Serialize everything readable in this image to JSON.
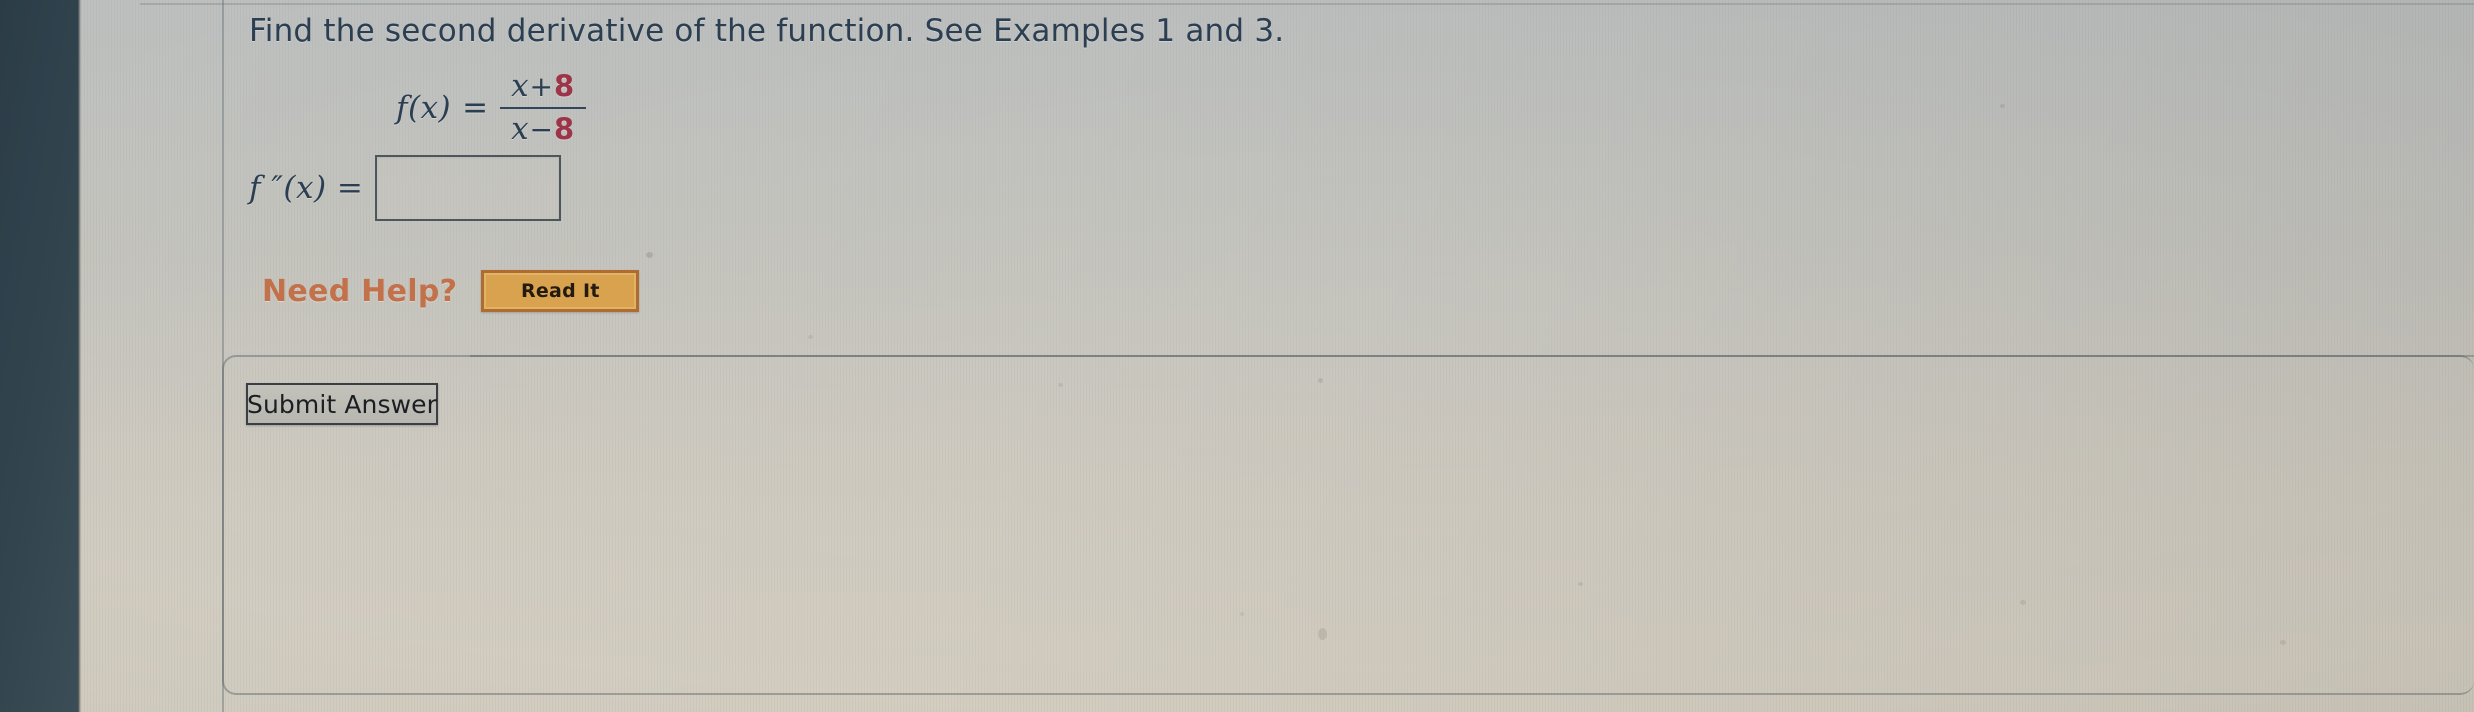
{
  "page": {
    "instruction": "Find the second derivative of the function. See Examples 1 and 3."
  },
  "equation": {
    "lhs": "f(x)",
    "equals": "=",
    "numerator_var": "x",
    "numerator_op": "+",
    "numerator_num": "8",
    "denominator_var": "x",
    "denominator_op": "−",
    "denominator_num": "8"
  },
  "answer": {
    "label": "f ″(x) =",
    "value": "",
    "placeholder": ""
  },
  "help": {
    "label": "Need Help?",
    "read_it_label": "Read It"
  },
  "footer": {
    "submit_label": "Submit Answer"
  },
  "colors": {
    "text": "#2c3f52",
    "accent_red": "#9e3448",
    "help_orange": "#c2714a",
    "read_it_fill": "#d9a24e",
    "read_it_border": "#b06b30",
    "bezel": "#32454f",
    "page_background": "#c6c3ba"
  }
}
